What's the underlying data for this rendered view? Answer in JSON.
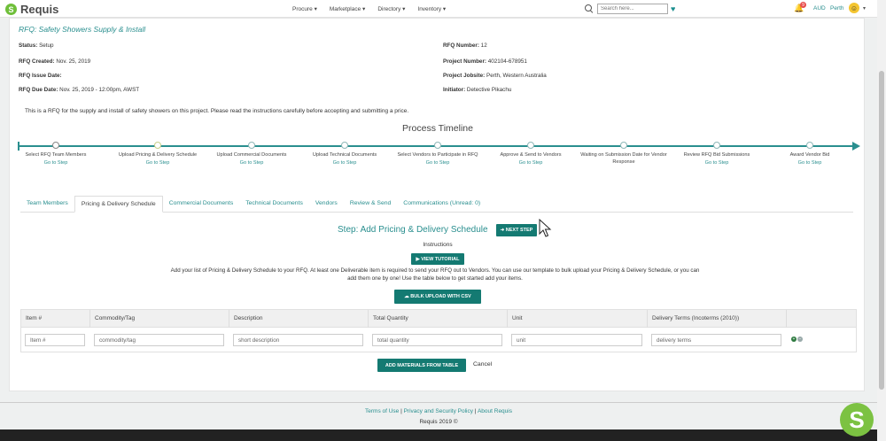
{
  "app": {
    "name": "Requis",
    "logo_glyph": "S"
  },
  "nav": {
    "menu": [
      "Procure ▾",
      "Marketplace ▾",
      "Directory ▾",
      "Inventory ▾"
    ],
    "search_placeholder": "Search here...",
    "notification_count": "9",
    "currency": "AUD",
    "user": "Perth",
    "avatar_glyph": "☺"
  },
  "rfq": {
    "title": "RFQ: Safety Showers Supply & Install",
    "left": [
      {
        "label": "Status:",
        "value": " Setup"
      },
      {
        "label": "RFQ Created:",
        "value": " Nov. 25, 2019"
      },
      {
        "label": "RFQ Issue Date:",
        "value": ""
      },
      {
        "label": "RFQ Due Date:",
        "value": " Nov. 25, 2019 - 12:00pm, AWST"
      }
    ],
    "right": [
      {
        "label": "RFQ Number:",
        "value": " 12"
      },
      {
        "label": "Project Number:",
        "value": " 402104-678951"
      },
      {
        "label": "Project Jobsite:",
        "value": " Perth, Western Australia"
      },
      {
        "label": "Initiator:",
        "value": " Detective Pikachu"
      }
    ],
    "intro": "This is a RFQ for the supply and install of safety showers on this project. Please read the instructions carefully before accepting and submitting a price."
  },
  "timeline": {
    "title": "Process Timeline",
    "steps": [
      {
        "label": "Select RFQ Team Members",
        "link": "Go to Step",
        "state": "done"
      },
      {
        "label": "Upload Pricing & Delivery Schedule",
        "link": "Go to Step",
        "state": "current"
      },
      {
        "label": "Upload Commercial Documents",
        "link": "Go to Step",
        "state": "todo"
      },
      {
        "label": "Upload Technical Documents",
        "link": "Go to Step",
        "state": "todo"
      },
      {
        "label": "Select Vendors to Participate in RFQ",
        "link": "Go to Step",
        "state": "todo"
      },
      {
        "label": "Approve & Send to Vendors",
        "link": "Go to Step",
        "state": "todo"
      },
      {
        "label": "Waiting on Submission Date for Vendor Response",
        "link": "",
        "state": "todo"
      },
      {
        "label": "Review RFQ Bid Submissions",
        "link": "Go to Step",
        "state": "todo"
      },
      {
        "label": "Award Vendor Bid",
        "link": "Go to Step",
        "state": "todo"
      }
    ]
  },
  "tabs": [
    {
      "label": "Team Members",
      "active": false
    },
    {
      "label": "Pricing & Delivery Schedule",
      "active": true
    },
    {
      "label": "Commercial Documents",
      "active": false
    },
    {
      "label": "Technical Documents",
      "active": false
    },
    {
      "label": "Vendors",
      "active": false
    },
    {
      "label": "Review & Send",
      "active": false
    },
    {
      "label": "Communications (Unread: 0)",
      "active": false
    }
  ],
  "step_panel": {
    "heading": "Step: Add Pricing & Delivery Schedule",
    "next_step": "➜ NEXT STEP",
    "instructions": "Instructions",
    "view_tutorial": "▶ VIEW TUTORIAL",
    "description": "Add your list of Pricing & Delivery Schedule to your RFQ. At least one Deliverable item is required to send your RFQ out to Vendors. You can use our template to bulk upload your Pricing & Delivery Schedule, or you can add them one by one! Use the table below to get started add your items.",
    "bulk_upload": "☁ BULK UPLOAD WITH CSV"
  },
  "table": {
    "headers": [
      "Item #",
      "Commodity/Tag",
      "Description",
      "Total Quantity",
      "Unit",
      "Delivery Terms (Incoterms (2010))"
    ],
    "placeholders": [
      "Item #",
      "commodity/tag",
      "short description",
      "total quantity",
      "unit",
      "delivery terms"
    ],
    "add_materials": "ADD MATERIALS FROM TABLE",
    "cancel": "Cancel"
  },
  "footer": {
    "terms": "Terms of Use",
    "privacy": "Privacy and Security Policy",
    "about": "About Requis",
    "sep": " | ",
    "copyright": "Requis 2019 ©"
  },
  "colors": {
    "brand": "#2a8f8f",
    "button": "#147a72",
    "logo": "#6fbf3a"
  }
}
